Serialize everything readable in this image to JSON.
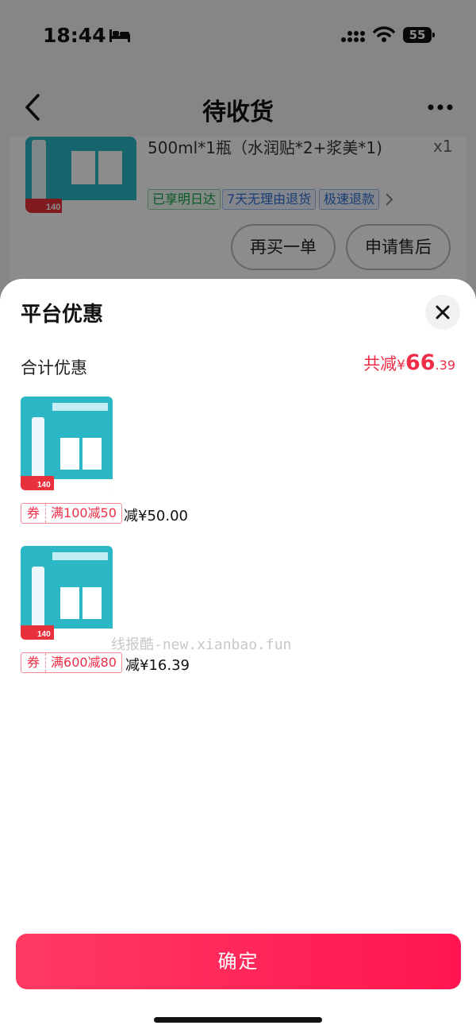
{
  "status_bar": {
    "time": "18:44",
    "battery": "55"
  },
  "nav": {
    "title": "待收货",
    "back_icon": "back-arrow-icon",
    "more_icon": "more-icon"
  },
  "order": {
    "name_text": "500ml*1瓶（水润贴*2+浆美*1)",
    "qty": "x1",
    "tags": [
      "已享明日达",
      "7天无理由退货",
      "极速退款"
    ],
    "buttons": {
      "rebuy": "再买一单",
      "after_sale": "申请售后"
    },
    "thumb_price": "140"
  },
  "sheet": {
    "title": "平台优惠",
    "total_label": "合计优惠",
    "total_prefix": "共减",
    "currency": "¥",
    "total_int": "66",
    "total_dec": ".39",
    "items": [
      {
        "coupon_type": "券",
        "coupon_cond": "满100减50",
        "discount": "减¥50.00",
        "thumb_price": "140"
      },
      {
        "coupon_type": "券",
        "coupon_cond": "满600减80",
        "discount": "减¥16.39",
        "thumb_price": "140"
      }
    ],
    "watermark": "线报酷-new.xianbao.fun",
    "confirm": "确定"
  },
  "colors": {
    "accent": "#f02d49",
    "button_start": "#ff3a62",
    "button_end": "#ff1551"
  }
}
